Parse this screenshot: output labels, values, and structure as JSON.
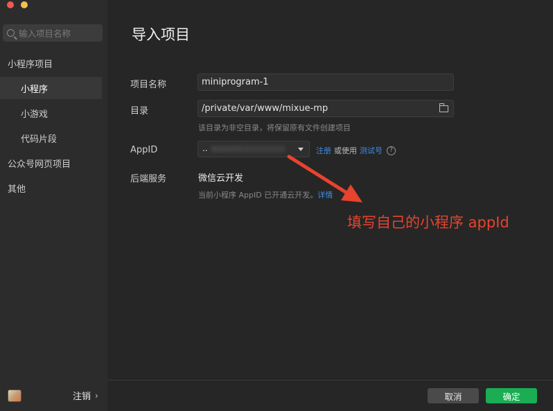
{
  "sidebar": {
    "search_placeholder": "输入项目名称",
    "items": [
      {
        "label": "小程序项目"
      },
      {
        "label": "小程序"
      },
      {
        "label": "小游戏"
      },
      {
        "label": "代码片段"
      },
      {
        "label": "公众号网页项目"
      },
      {
        "label": "其他"
      }
    ],
    "logout_label": "注销",
    "logout_chevron": "›"
  },
  "main": {
    "title": "导入项目",
    "project_name": {
      "label": "项目名称",
      "value": "miniprogram-1"
    },
    "directory": {
      "label": "目录",
      "value": "/private/var/www/mixue-mp",
      "hint": "该目录为非空目录，将保留原有文件创建项目"
    },
    "appid": {
      "label": "AppID",
      "value": "..",
      "register_link": "注册",
      "or_use": "或使用",
      "test_link": "测试号",
      "help": "?"
    },
    "backend": {
      "label": "后端服务",
      "value": "微信云开发",
      "hint_prefix": "当前小程序 AppID 已开通云开发。",
      "hint_link": "详情"
    },
    "annotation": "填写自己的小程序 appId"
  },
  "footer": {
    "cancel_label": "取消",
    "ok_label": "确定"
  },
  "colors": {
    "accent": "#1aad53",
    "link": "#3d8ee6",
    "annotation": "#e8432e"
  }
}
